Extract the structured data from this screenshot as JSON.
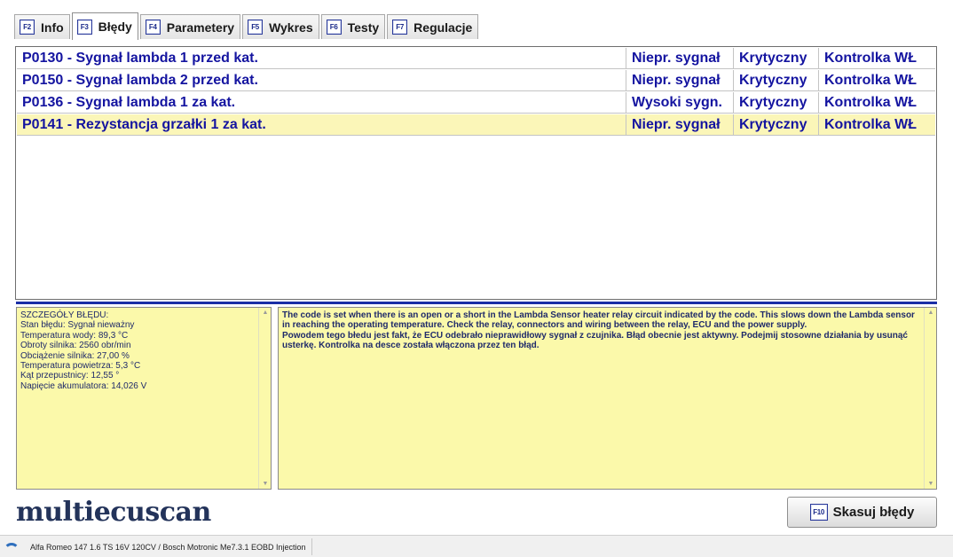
{
  "tabs": [
    {
      "key": "F2",
      "label": "Info",
      "active": false
    },
    {
      "key": "F3",
      "label": "Błędy",
      "active": true
    },
    {
      "key": "F4",
      "label": "Parametery",
      "active": false
    },
    {
      "key": "F5",
      "label": "Wykres",
      "active": false
    },
    {
      "key": "F6",
      "label": "Testy",
      "active": false
    },
    {
      "key": "F7",
      "label": "Regulacje",
      "active": false
    }
  ],
  "errors": [
    {
      "code": "P0130 - Sygnał lambda 1 przed kat.",
      "status": "Niepr. sygnał",
      "severity": "Krytyczny",
      "lamp": "Kontrolka WŁ",
      "selected": false
    },
    {
      "code": "P0150 - Sygnał lambda 2 przed kat.",
      "status": "Niepr. sygnał",
      "severity": "Krytyczny",
      "lamp": "Kontrolka WŁ",
      "selected": false
    },
    {
      "code": "P0136 - Sygnał lambda 1 za kat.",
      "status": "Wysoki sygn.",
      "severity": "Krytyczny",
      "lamp": "Kontrolka WŁ",
      "selected": false
    },
    {
      "code": "P0141 - Rezystancja grzałki 1 za kat.",
      "status": "Niepr. sygnał",
      "severity": "Krytyczny",
      "lamp": "Kontrolka WŁ",
      "selected": true
    }
  ],
  "details": {
    "lines": [
      "SZCZEGÓŁY BŁĘDU:",
      "Stan błędu: Sygnał nieważny",
      "Temperatura wody: 89,3 °C",
      "Obroty silnika: 2560 obr/min",
      "Obciążenie silnika: 27,00 %",
      "Temperatura powietrza: 5,3 °C",
      "Kąt przepustnicy: 12,55 °",
      "Napięcie akumulatora: 14,026 V"
    ]
  },
  "description": {
    "paragraph1": "The code is set when there is an open or a short in the Lambda Sensor heater relay circuit indicated by the code. This slows down the Lambda sensor in reaching the operating temperature. Check the relay, connectors and wiring between the relay, ECU and the power supply.",
    "paragraph2": "Powodem tego błedu jest fakt, że ECU odebrało nieprawidłowy sygnał z czujnika. Błąd obecnie jest aktywny. Podejmij stosowne działania by usunąć usterkę. Kontrolka na desce została włączona przez ten błąd."
  },
  "logo": "multiecuscan",
  "clear_button": {
    "key": "F10",
    "label": "Skasuj błędy"
  },
  "statusbar": {
    "vehicle": "Alfa Romeo 147 1.6 TS 16V 120CV / Bosch Motronic Me7.3.1 EOBD Injection"
  },
  "colors": {
    "accent": "#1b2fa6",
    "error_text": "#1414a0",
    "selected_row": "#fbf6b8",
    "pane_bg": "#fbf9aa"
  }
}
